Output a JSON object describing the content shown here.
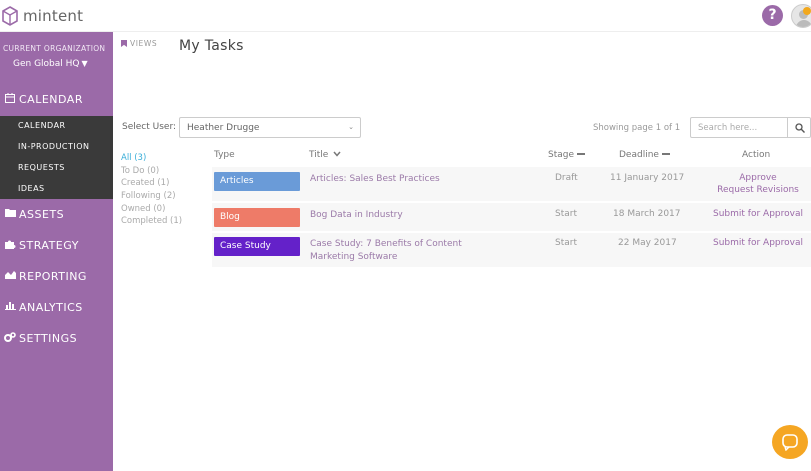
{
  "app": {
    "name": "mintent"
  },
  "header": {
    "help_label": "?"
  },
  "sidebar": {
    "org_label": "CURRENT ORGANIZATION",
    "org_name": "Gen Global HQ",
    "calendar": {
      "label": "CALENDAR",
      "icon": "calendar-icon"
    },
    "subitems": [
      {
        "label": "CALENDAR"
      },
      {
        "label": "IN-PRODUCTION"
      },
      {
        "label": "REQUESTS"
      },
      {
        "label": "IDEAS"
      }
    ],
    "items": [
      {
        "label": "ASSETS",
        "icon": "folder-icon"
      },
      {
        "label": "STRATEGY",
        "icon": "puzzle-icon"
      },
      {
        "label": "REPORTING",
        "icon": "area-chart-icon"
      },
      {
        "label": "ANALYTICS",
        "icon": "bar-chart-icon"
      },
      {
        "label": "SETTINGS",
        "icon": "gears-icon"
      }
    ]
  },
  "main": {
    "views_label": "VIEWS",
    "title": "My Tasks",
    "select_user": {
      "label": "Select User:",
      "value": "Heather Drugge"
    },
    "showing": "Showing page 1 of 1",
    "search": {
      "placeholder": "Search here..."
    },
    "filters": [
      {
        "label": "All (3)"
      },
      {
        "label": "To Do (0)"
      },
      {
        "label": "Created (1)"
      },
      {
        "label": "Following (2)"
      },
      {
        "label": "Owned (0)"
      },
      {
        "label": "Completed (1)"
      }
    ],
    "columns": {
      "type": "Type",
      "title": "Title",
      "stage": "Stage",
      "deadline": "Deadline",
      "action": "Action"
    },
    "rows": [
      {
        "type": "Articles",
        "color": "#6a9bd8",
        "title": "Articles: Sales Best Practices",
        "stage": "Draft",
        "deadline": "11 January 2017",
        "action": "Approve",
        "action2": "Request Revisions"
      },
      {
        "type": "Blog",
        "color": "#ee7b68",
        "title": "Bog Data in Industry",
        "stage": "Start",
        "deadline": "18 March 2017",
        "action": "Submit for Approval",
        "action2": ""
      },
      {
        "type": "Case Study",
        "color": "#6421c9",
        "title": "Case Study: 7 Benefits of Content Marketing Software",
        "stage": "Start",
        "deadline": "22 May 2017",
        "action": "Submit for Approval",
        "action2": ""
      }
    ]
  },
  "colors": {
    "sidebar": "#9b6aa8",
    "subnav": "#3a3a3a",
    "link": "#3aaed8",
    "chat": "#f5a623"
  }
}
